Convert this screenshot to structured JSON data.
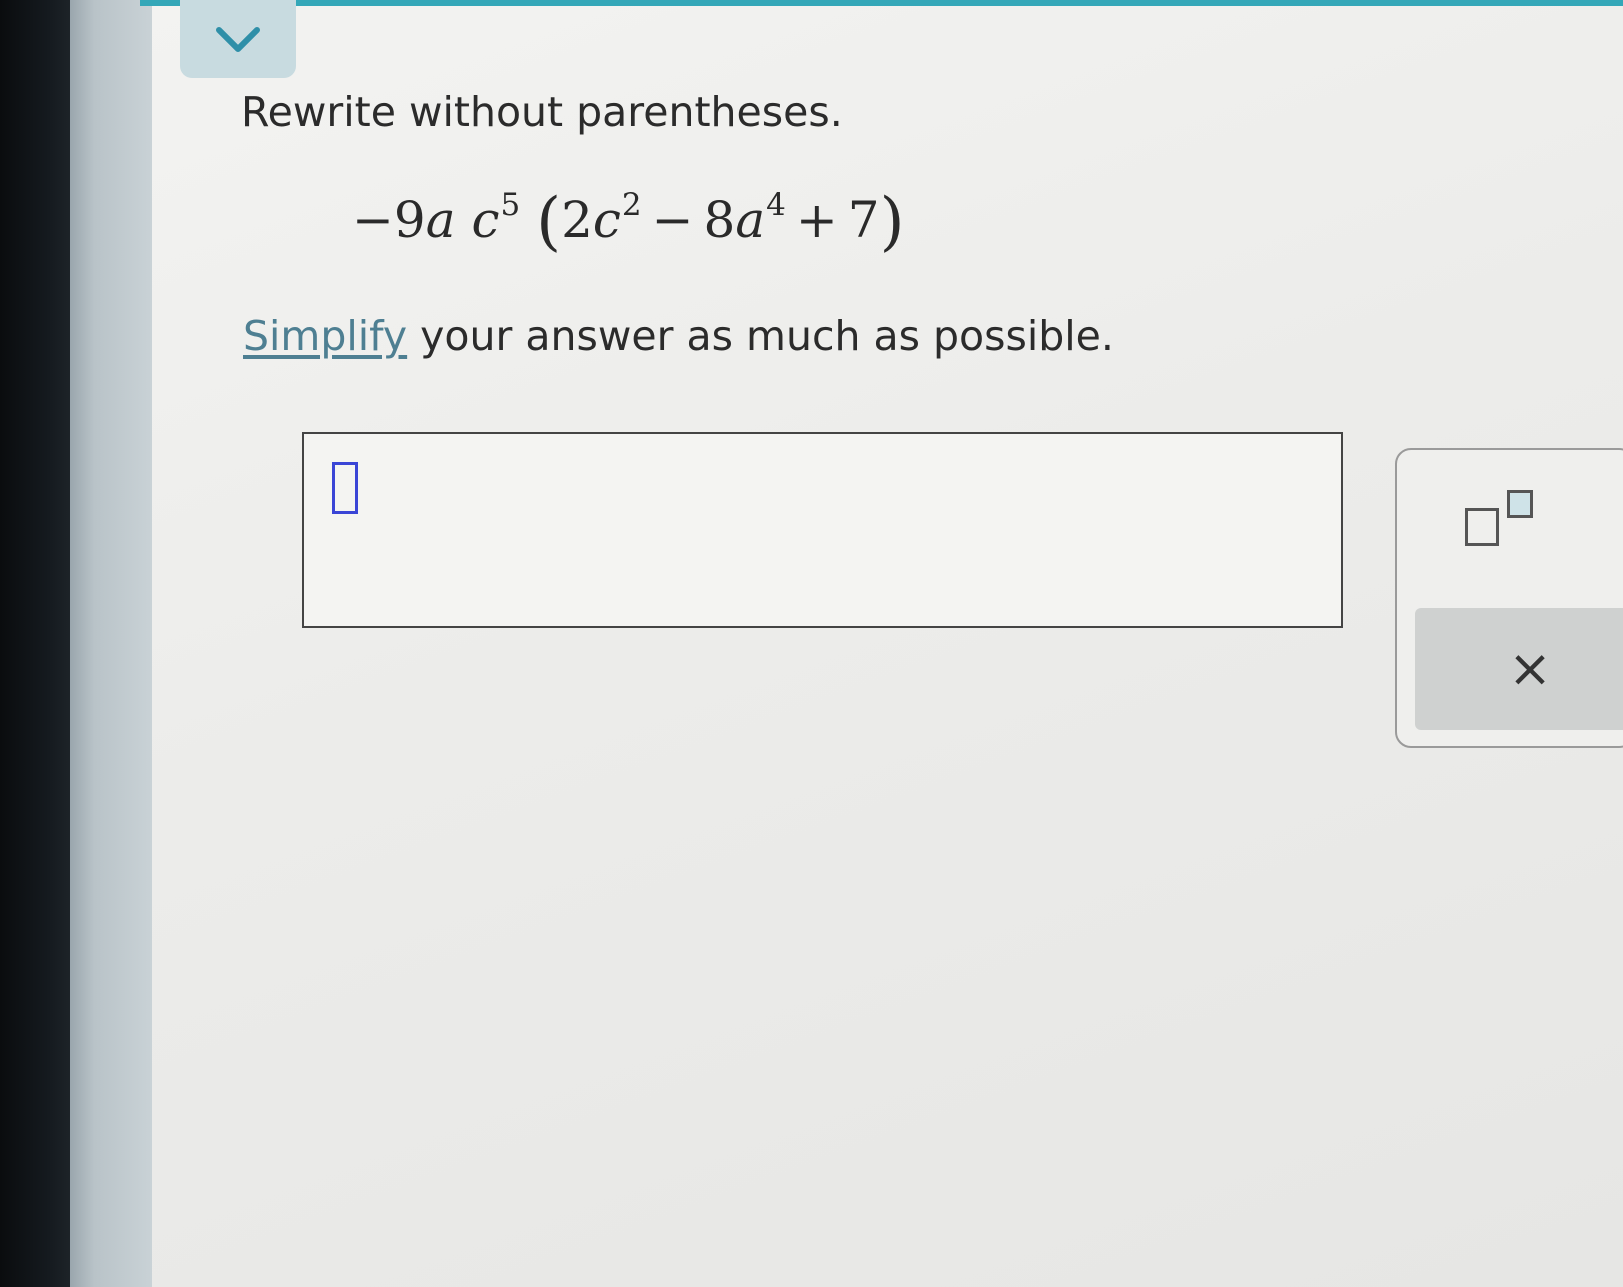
{
  "question": {
    "prompt": "Rewrite without parentheses.",
    "expression": {
      "coefficient": "−9",
      "var_a": "a",
      "var_c": "c",
      "exp_c": "5",
      "open_paren": "(",
      "term1_coef": "2",
      "term1_var": "c",
      "term1_exp": "2",
      "op1": "−",
      "term2_coef": "8",
      "term2_var": "a",
      "term2_exp": "4",
      "op2": "+",
      "term3": "7",
      "close_paren": ")"
    },
    "instruction_link": "Simplify",
    "instruction_rest": " your answer as much as possible."
  },
  "palette": {
    "clear_label": "×"
  },
  "colors": {
    "accent": "#34a7b8",
    "link": "#4e7f92",
    "cursor": "#3a45d6"
  },
  "icons": {
    "collapse": "chevron-down-icon",
    "superscript": "superscript-icon",
    "clear": "close-icon"
  }
}
